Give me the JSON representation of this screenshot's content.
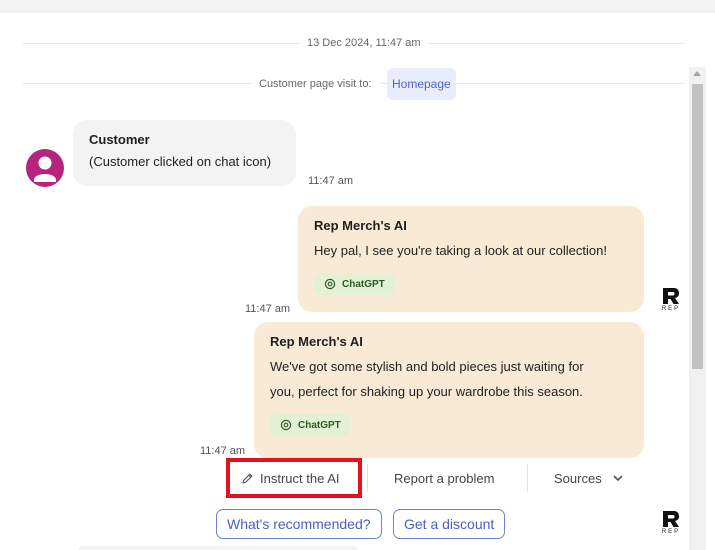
{
  "header": {
    "date_time": "13 Dec 2024, 11:47 am"
  },
  "visit": {
    "label": "Customer page visit to:",
    "link": "Homepage"
  },
  "messages": [
    {
      "author": "Customer",
      "text": "(Customer clicked on chat icon)",
      "time": "11:47 am"
    },
    {
      "author": "Rep Merch's AI",
      "text": "Hey pal, I see you're taking a look at our collection!",
      "source": "ChatGPT",
      "time": "11:47 am"
    },
    {
      "author": "Rep Merch's AI",
      "text_line1": "We've got some stylish and bold pieces just waiting for",
      "text_line2": "you, perfect for shaking up your wardrobe this season.",
      "source": "ChatGPT",
      "time": "11:47 am"
    }
  ],
  "actions": {
    "instruct": "Instruct the AI",
    "report": "Report a problem",
    "sources": "Sources"
  },
  "suggestions": [
    "What's recommended?",
    "Get a discount"
  ],
  "logo": {
    "text": "REP"
  },
  "colors": {
    "accent_blue": "#4660c7",
    "highlight_red": "#e0141e",
    "ai_bubble": "#f8ead5",
    "customer_avatar": "#b5257f",
    "source_chip": "#e2f1d4"
  },
  "icons": [
    "user-avatar-icon",
    "chatgpt-icon",
    "pencil-icon",
    "chevron-down-icon",
    "rep-logo-icon"
  ]
}
